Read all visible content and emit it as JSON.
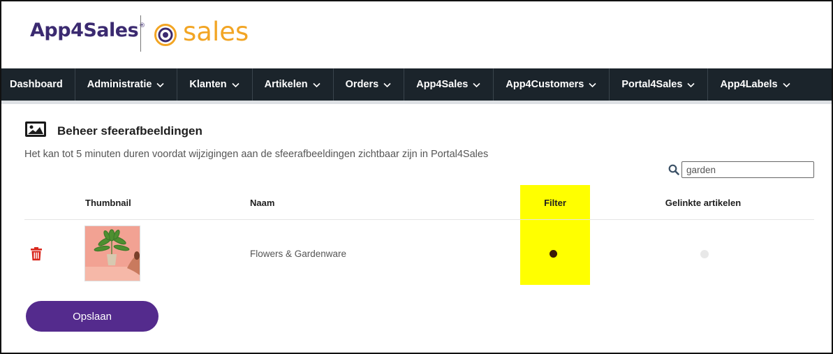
{
  "brand": {
    "logo_text_prefix": "App",
    "logo_text_four": "4",
    "logo_text_suffix": "Sales",
    "logo_mark": "®",
    "product": "sales",
    "logo_color": "#3b2a70",
    "accent": "#f2a524"
  },
  "nav": {
    "items": [
      {
        "label": "Dashboard",
        "has_dropdown": false
      },
      {
        "label": "Administratie",
        "has_dropdown": true
      },
      {
        "label": "Klanten",
        "has_dropdown": true
      },
      {
        "label": "Artikelen",
        "has_dropdown": true
      },
      {
        "label": "Orders",
        "has_dropdown": true
      },
      {
        "label": "App4Sales",
        "has_dropdown": true
      },
      {
        "label": "App4Customers",
        "has_dropdown": true
      },
      {
        "label": "Portal4Sales",
        "has_dropdown": true
      },
      {
        "label": "App4Labels",
        "has_dropdown": true
      }
    ],
    "background": "#1b242b"
  },
  "page": {
    "title": "Beheer sfeerafbeeldingen",
    "title_icon": "image-icon",
    "info": "Het kan tot 5 minuten duren voordat wijzigingen aan de sfeerafbeeldingen zichtbaar zijn in Portal4Sales"
  },
  "search": {
    "value": "garden",
    "icon": "search-icon"
  },
  "table": {
    "columns": [
      "Thumbnail",
      "Naam",
      "Filter",
      "Gelinkte artikelen"
    ],
    "rows": [
      {
        "naam": "Flowers & Gardenware",
        "filter": true,
        "linked": false,
        "delete_icon": "trash-icon"
      }
    ],
    "highlight_color": "#ffff00"
  },
  "actions": {
    "save_label": "Opslaan",
    "save_color": "#542b8d"
  }
}
